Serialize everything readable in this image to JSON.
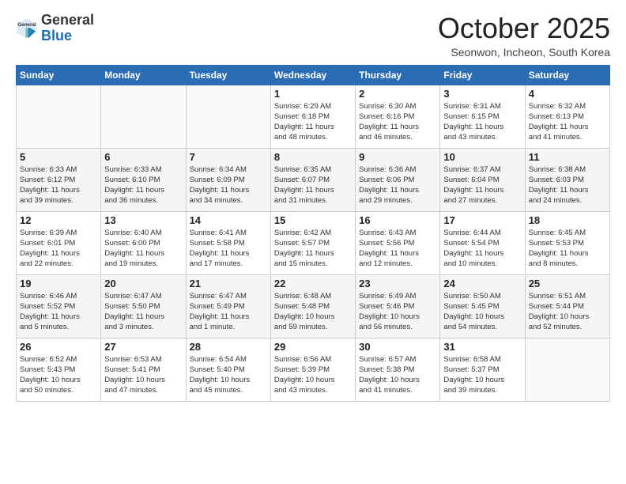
{
  "header": {
    "logo_general": "General",
    "logo_blue": "Blue",
    "month_title": "October 2025",
    "location": "Seonwon, Incheon, South Korea"
  },
  "weekdays": [
    "Sunday",
    "Monday",
    "Tuesday",
    "Wednesday",
    "Thursday",
    "Friday",
    "Saturday"
  ],
  "weeks": [
    [
      {
        "day": "",
        "info": ""
      },
      {
        "day": "",
        "info": ""
      },
      {
        "day": "",
        "info": ""
      },
      {
        "day": "1",
        "info": "Sunrise: 6:29 AM\nSunset: 6:18 PM\nDaylight: 11 hours\nand 48 minutes."
      },
      {
        "day": "2",
        "info": "Sunrise: 6:30 AM\nSunset: 6:16 PM\nDaylight: 11 hours\nand 46 minutes."
      },
      {
        "day": "3",
        "info": "Sunrise: 6:31 AM\nSunset: 6:15 PM\nDaylight: 11 hours\nand 43 minutes."
      },
      {
        "day": "4",
        "info": "Sunrise: 6:32 AM\nSunset: 6:13 PM\nDaylight: 11 hours\nand 41 minutes."
      }
    ],
    [
      {
        "day": "5",
        "info": "Sunrise: 6:33 AM\nSunset: 6:12 PM\nDaylight: 11 hours\nand 39 minutes."
      },
      {
        "day": "6",
        "info": "Sunrise: 6:33 AM\nSunset: 6:10 PM\nDaylight: 11 hours\nand 36 minutes."
      },
      {
        "day": "7",
        "info": "Sunrise: 6:34 AM\nSunset: 6:09 PM\nDaylight: 11 hours\nand 34 minutes."
      },
      {
        "day": "8",
        "info": "Sunrise: 6:35 AM\nSunset: 6:07 PM\nDaylight: 11 hours\nand 31 minutes."
      },
      {
        "day": "9",
        "info": "Sunrise: 6:36 AM\nSunset: 6:06 PM\nDaylight: 11 hours\nand 29 minutes."
      },
      {
        "day": "10",
        "info": "Sunrise: 6:37 AM\nSunset: 6:04 PM\nDaylight: 11 hours\nand 27 minutes."
      },
      {
        "day": "11",
        "info": "Sunrise: 6:38 AM\nSunset: 6:03 PM\nDaylight: 11 hours\nand 24 minutes."
      }
    ],
    [
      {
        "day": "12",
        "info": "Sunrise: 6:39 AM\nSunset: 6:01 PM\nDaylight: 11 hours\nand 22 minutes."
      },
      {
        "day": "13",
        "info": "Sunrise: 6:40 AM\nSunset: 6:00 PM\nDaylight: 11 hours\nand 19 minutes."
      },
      {
        "day": "14",
        "info": "Sunrise: 6:41 AM\nSunset: 5:58 PM\nDaylight: 11 hours\nand 17 minutes."
      },
      {
        "day": "15",
        "info": "Sunrise: 6:42 AM\nSunset: 5:57 PM\nDaylight: 11 hours\nand 15 minutes."
      },
      {
        "day": "16",
        "info": "Sunrise: 6:43 AM\nSunset: 5:56 PM\nDaylight: 11 hours\nand 12 minutes."
      },
      {
        "day": "17",
        "info": "Sunrise: 6:44 AM\nSunset: 5:54 PM\nDaylight: 11 hours\nand 10 minutes."
      },
      {
        "day": "18",
        "info": "Sunrise: 6:45 AM\nSunset: 5:53 PM\nDaylight: 11 hours\nand 8 minutes."
      }
    ],
    [
      {
        "day": "19",
        "info": "Sunrise: 6:46 AM\nSunset: 5:52 PM\nDaylight: 11 hours\nand 5 minutes."
      },
      {
        "day": "20",
        "info": "Sunrise: 6:47 AM\nSunset: 5:50 PM\nDaylight: 11 hours\nand 3 minutes."
      },
      {
        "day": "21",
        "info": "Sunrise: 6:47 AM\nSunset: 5:49 PM\nDaylight: 11 hours\nand 1 minute."
      },
      {
        "day": "22",
        "info": "Sunrise: 6:48 AM\nSunset: 5:48 PM\nDaylight: 10 hours\nand 59 minutes."
      },
      {
        "day": "23",
        "info": "Sunrise: 6:49 AM\nSunset: 5:46 PM\nDaylight: 10 hours\nand 56 minutes."
      },
      {
        "day": "24",
        "info": "Sunrise: 6:50 AM\nSunset: 5:45 PM\nDaylight: 10 hours\nand 54 minutes."
      },
      {
        "day": "25",
        "info": "Sunrise: 6:51 AM\nSunset: 5:44 PM\nDaylight: 10 hours\nand 52 minutes."
      }
    ],
    [
      {
        "day": "26",
        "info": "Sunrise: 6:52 AM\nSunset: 5:43 PM\nDaylight: 10 hours\nand 50 minutes."
      },
      {
        "day": "27",
        "info": "Sunrise: 6:53 AM\nSunset: 5:41 PM\nDaylight: 10 hours\nand 47 minutes."
      },
      {
        "day": "28",
        "info": "Sunrise: 6:54 AM\nSunset: 5:40 PM\nDaylight: 10 hours\nand 45 minutes."
      },
      {
        "day": "29",
        "info": "Sunrise: 6:56 AM\nSunset: 5:39 PM\nDaylight: 10 hours\nand 43 minutes."
      },
      {
        "day": "30",
        "info": "Sunrise: 6:57 AM\nSunset: 5:38 PM\nDaylight: 10 hours\nand 41 minutes."
      },
      {
        "day": "31",
        "info": "Sunrise: 6:58 AM\nSunset: 5:37 PM\nDaylight: 10 hours\nand 39 minutes."
      },
      {
        "day": "",
        "info": ""
      }
    ]
  ]
}
